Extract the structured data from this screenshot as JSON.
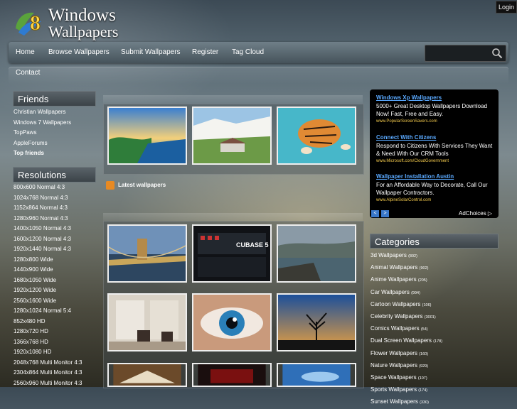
{
  "header": {
    "logo_text_line1": "Windows",
    "logo_text_line2": "Wallpapers",
    "login_label": "Login"
  },
  "nav": {
    "items": [
      "Home",
      "Browse Wallpapers",
      "Submit Wallpapers",
      "Register",
      "Tag Cloud"
    ],
    "contact_label": "Contact",
    "search_placeholder": ""
  },
  "friends": {
    "title": "Friends",
    "items": [
      "Christian Wallpapers",
      "Windows 7 Wallpapers",
      "TopPaws",
      "AppleForums",
      "Top friends"
    ]
  },
  "resolutions": {
    "title": "Resolutions",
    "items": [
      "800x600 Normal 4:3",
      "1024x768 Normal 4:3",
      "1152x864 Normal 4:3",
      "1280x960 Normal 4:3",
      "1400x1050 Normal 4:3",
      "1600x1200 Normal 4:3",
      "1920x1440 Normal 4:3",
      "1280x800 Wide",
      "1440x900 Wide",
      "1680x1050 Wide",
      "1920x1200 Wide",
      "2560x1600 Wide",
      "1280x1024 Normal 5:4",
      "852x480 HD",
      "1280x720 HD",
      "1366x768 HD",
      "1920x1080 HD",
      "2048x768 Multi Monitor 4:3",
      "2304x864 Multi Monitor 4:3",
      "2560x960 Multi Monitor 4:3"
    ]
  },
  "latest": {
    "label": "Latest wallpapers"
  },
  "thumbnails": {
    "featured": [
      "ocean-coastline",
      "white-cliffs",
      "swimming-tiger"
    ],
    "latest": [
      "chain-bridge",
      "cubase-5",
      "rocky-coast",
      "empty-room",
      "blue-eye",
      "lone-tree",
      "book",
      "cubase",
      "sky"
    ],
    "cubase_text": "CUBASE 5"
  },
  "ad": {
    "items": [
      {
        "title": "Windows Xp Wallpapers",
        "body": "5000+ Great Desktop Wallpapers Download Now! Fast, Free and Easy.",
        "url": "www.PopularScreenSavers.com"
      },
      {
        "title": "Connect With Citizens",
        "body": "Respond to Citizens With Services They Want & Need With Our CRM Tools",
        "url": "www.Microsoft.com/CloudGovernment"
      },
      {
        "title": "Wallpaper Installation Austin",
        "body": "For an Affordable Way to Decorate, Call Our Wallpaper Contractors.",
        "url": "www.AlpineSolarControl.com"
      }
    ],
    "prev_label": "<",
    "next_label": ">",
    "adchoices_label": "AdChoices"
  },
  "categories": {
    "title": "Categories",
    "items": [
      {
        "name": "3d Wallpapers",
        "count": "(802)"
      },
      {
        "name": "Animal Wallpapers",
        "count": "(902)"
      },
      {
        "name": "Anime Wallpapers",
        "count": "(205)"
      },
      {
        "name": "Car Wallpapers",
        "count": "(994)"
      },
      {
        "name": "Cartoon Wallpapers",
        "count": "(106)"
      },
      {
        "name": "Celebrity Wallpapers",
        "count": "(3001)"
      },
      {
        "name": "Comics Wallpapers",
        "count": "(54)"
      },
      {
        "name": "Dual Screen Wallpapers",
        "count": "(178)"
      },
      {
        "name": "Flower Wallpapers",
        "count": "(160)"
      },
      {
        "name": "Nature Wallpapers",
        "count": "(929)"
      },
      {
        "name": "Space Wallpapers",
        "count": "(107)"
      },
      {
        "name": "Sports Wallpapers",
        "count": "(174)"
      },
      {
        "name": "Sunset Wallpapers",
        "count": "(330)"
      }
    ]
  }
}
